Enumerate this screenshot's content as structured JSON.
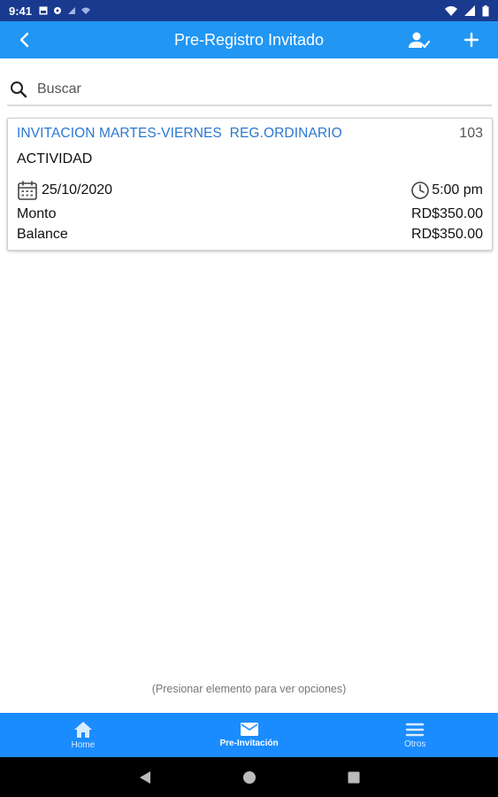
{
  "status_bar": {
    "time": "9:41"
  },
  "app_bar": {
    "title": "Pre-Registro Invitado"
  },
  "search": {
    "placeholder": "Buscar"
  },
  "card": {
    "name": "INVITACION MARTES-VIERNES  REG.ORDINARIO",
    "number": "103",
    "type": "ACTIVIDAD",
    "date": "25/10/2020",
    "time": "5:00 pm",
    "monto_label": "Monto",
    "monto_value": "RD$350.00",
    "balance_label": "Balance",
    "balance_value": "RD$350.00"
  },
  "hint": "(Presionar elemento para ver opciones)",
  "bottom_nav": {
    "items": [
      {
        "label": "Home",
        "icon": "home-icon"
      },
      {
        "label": "Pre-Invitación",
        "icon": "envelope-icon"
      },
      {
        "label": "Otros",
        "icon": "menu-icon"
      }
    ],
    "active_index": 1
  },
  "colors": {
    "status_bar": "#1a3a8f",
    "app_bar": "#2196f3",
    "bottom_nav": "#1a8cff",
    "card_title": "#2a78d0"
  }
}
